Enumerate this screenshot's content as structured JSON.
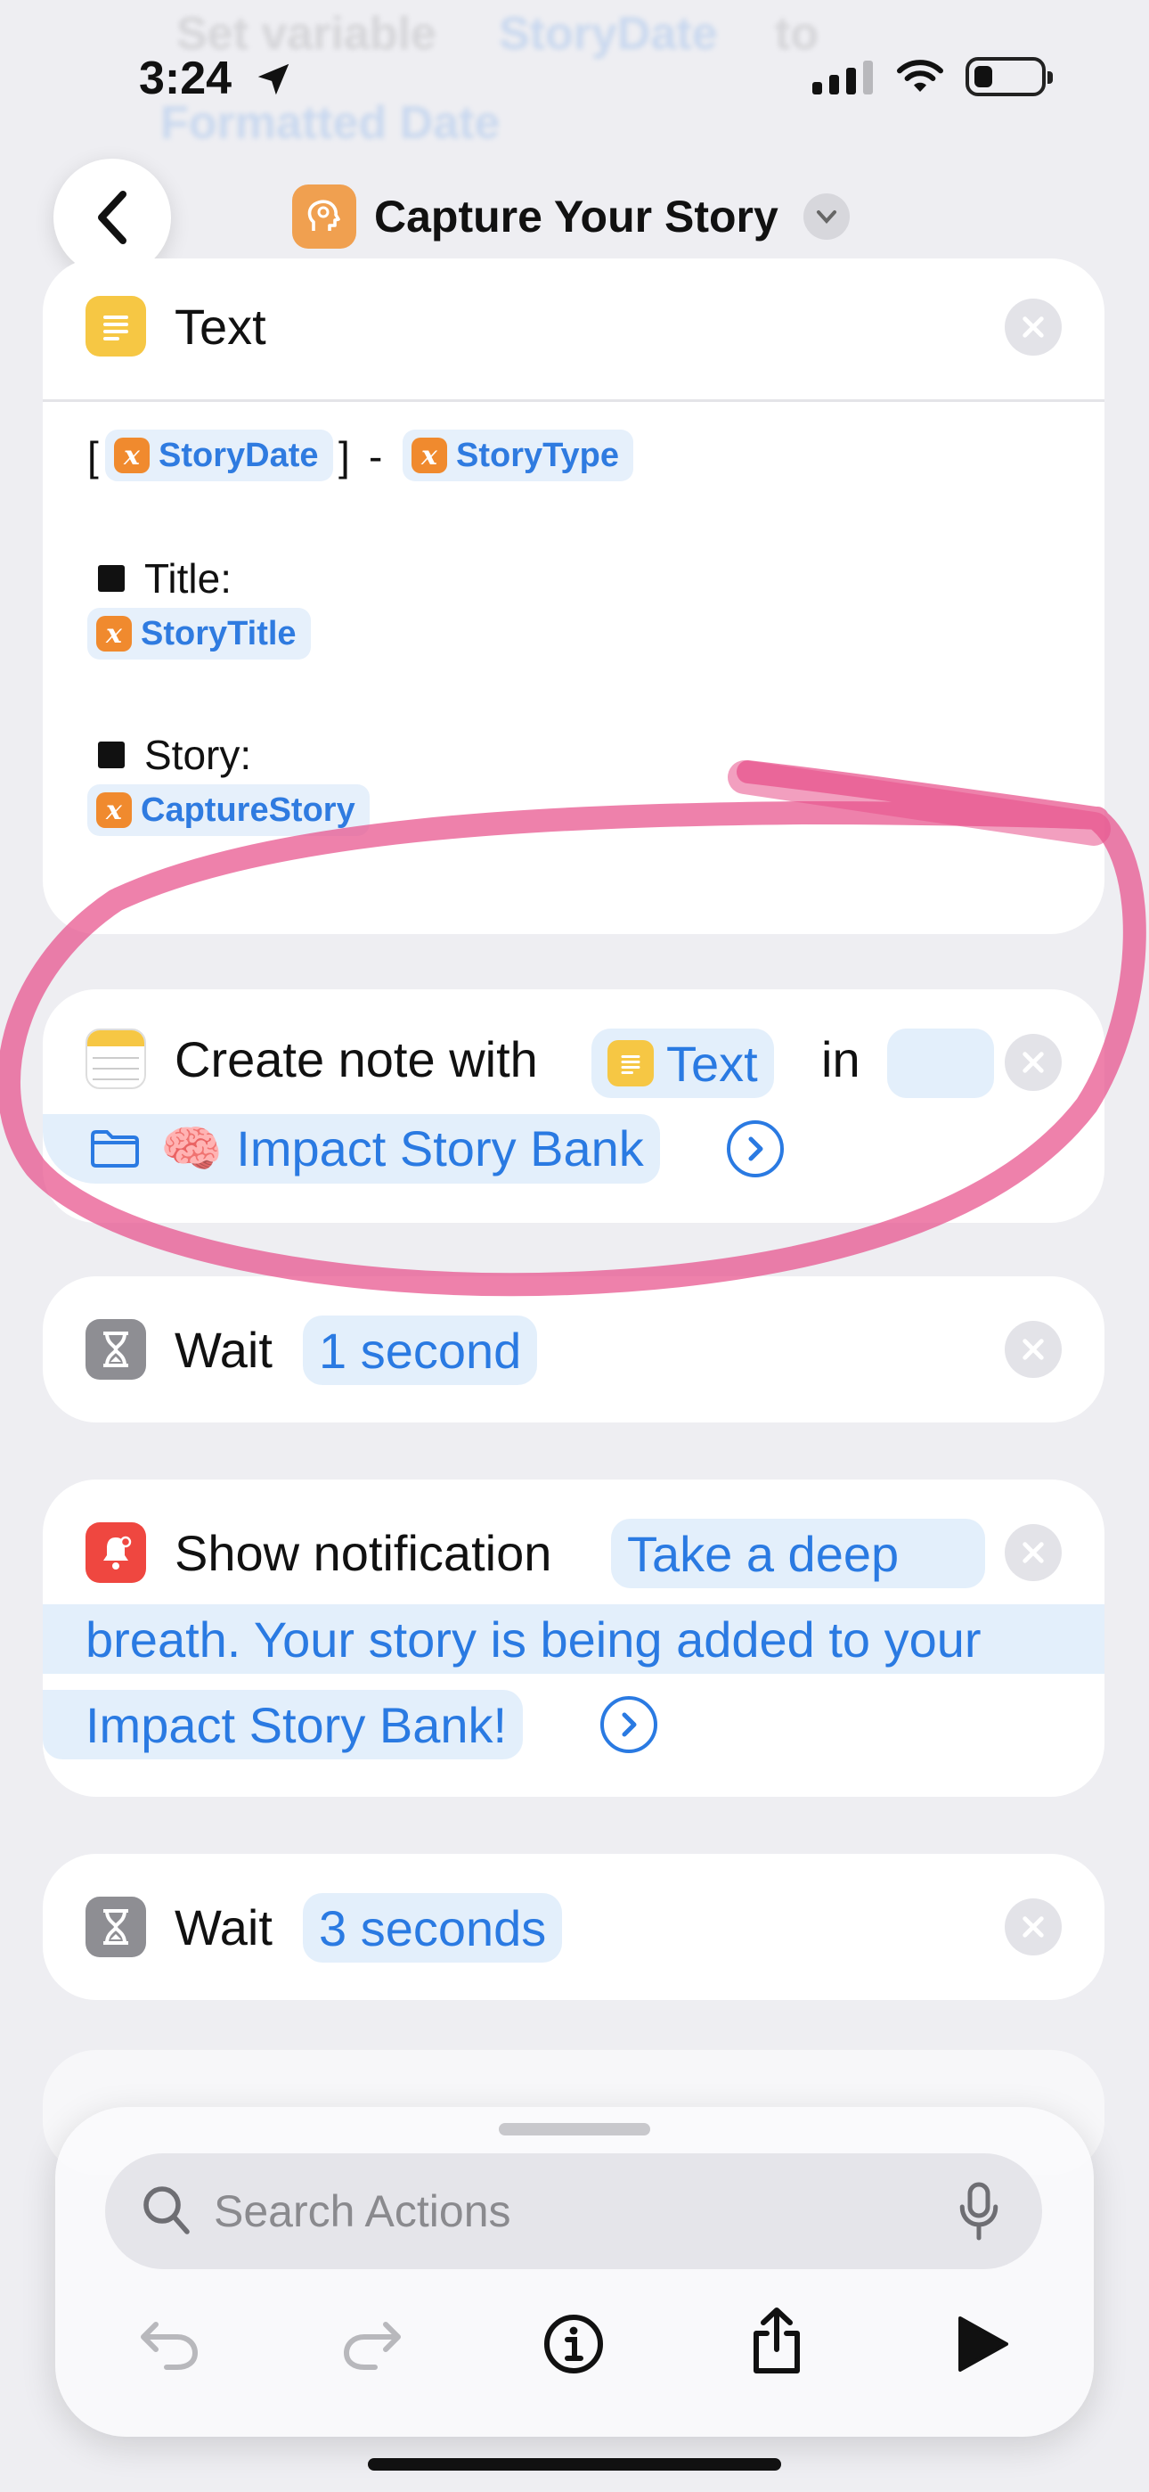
{
  "status": {
    "time": "3:24"
  },
  "ghost": {
    "set_variable": "Set variable",
    "var": "StoryDate",
    "to": "to",
    "formatted": "Formatted Date"
  },
  "nav": {
    "title": "Capture Your Story"
  },
  "text_action": {
    "label": "Text",
    "open_bracket": "[",
    "close_bracket": "]",
    "dash": "-",
    "vars": {
      "date": "StoryDate",
      "type": "StoryType",
      "title": "StoryTitle",
      "story": "CaptureStory"
    },
    "title_label": "Title:",
    "story_label": "Story:"
  },
  "create_note": {
    "label": "Create note with",
    "text_pill": "Text",
    "in_label": "in",
    "folder": "🧠 Impact Story Bank"
  },
  "wait1": {
    "label": "Wait",
    "value": "1 second"
  },
  "notification": {
    "label": "Show notification",
    "line1": "Take a deep",
    "line2": "breath. Your story is being added to your",
    "line3": "Impact Story Bank!"
  },
  "wait2": {
    "label": "Wait",
    "value": "3 seconds"
  },
  "search": {
    "placeholder": "Search Actions"
  },
  "colors": {
    "accent": "#2a7ae2",
    "highlight": "#e8508a"
  }
}
